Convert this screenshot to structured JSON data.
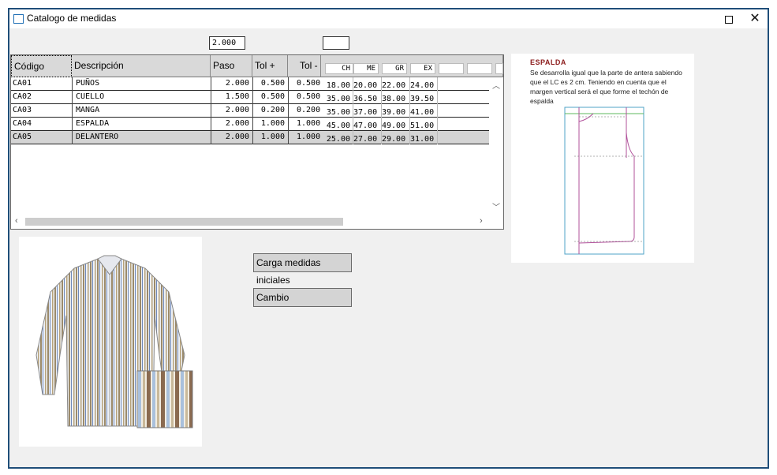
{
  "window": {
    "title": "Catalogo de medidas"
  },
  "inputs": {
    "step_value": "2.000",
    "blank_value": ""
  },
  "table": {
    "headers": {
      "codigo": "Código",
      "descripcion": "Descripción",
      "paso": "Paso",
      "tol_plus": "Tol +",
      "tol_minus": "Tol -"
    },
    "size_headers": [
      "CH",
      "ME",
      "GR",
      "EX",
      "",
      ""
    ],
    "rows": [
      {
        "codigo": "CA01",
        "descripcion": "PUÑOS",
        "paso": "2.000",
        "tol_plus": "0.500",
        "tol_minus": "0.500",
        "sizes": [
          "18.00",
          "20.00",
          "22.00",
          "24.00"
        ]
      },
      {
        "codigo": "CA02",
        "descripcion": "CUELLO",
        "paso": "1.500",
        "tol_plus": "0.500",
        "tol_minus": "0.500",
        "sizes": [
          "35.00",
          "36.50",
          "38.00",
          "39.50"
        ]
      },
      {
        "codigo": "CA03",
        "descripcion": "MANGA",
        "paso": "2.000",
        "tol_plus": "0.200",
        "tol_minus": "0.200",
        "sizes": [
          "35.00",
          "37.00",
          "39.00",
          "41.00"
        ]
      },
      {
        "codigo": "CA04",
        "descripcion": "ESPALDA",
        "paso": "2.000",
        "tol_plus": "1.000",
        "tol_minus": "1.000",
        "sizes": [
          "45.00",
          "47.00",
          "49.00",
          "51.00"
        ]
      },
      {
        "codigo": "CA05",
        "descripcion": "DELANTERO",
        "paso": "2.000",
        "tol_plus": "1.000",
        "tol_minus": "1.000",
        "sizes": [
          "25.00",
          "27.00",
          "29.00",
          "31.00"
        ]
      }
    ]
  },
  "doc": {
    "heading": "ESPALDA",
    "text": "Se desarrolla igual que la parte de antera sabiendo que el LC es 2 cm. Teniendo en cuenta que el margen vertical será el que forme el techón de espalda"
  },
  "buttons": {
    "load_initial": "Carga medidas iniciales",
    "change": "Cambio"
  }
}
